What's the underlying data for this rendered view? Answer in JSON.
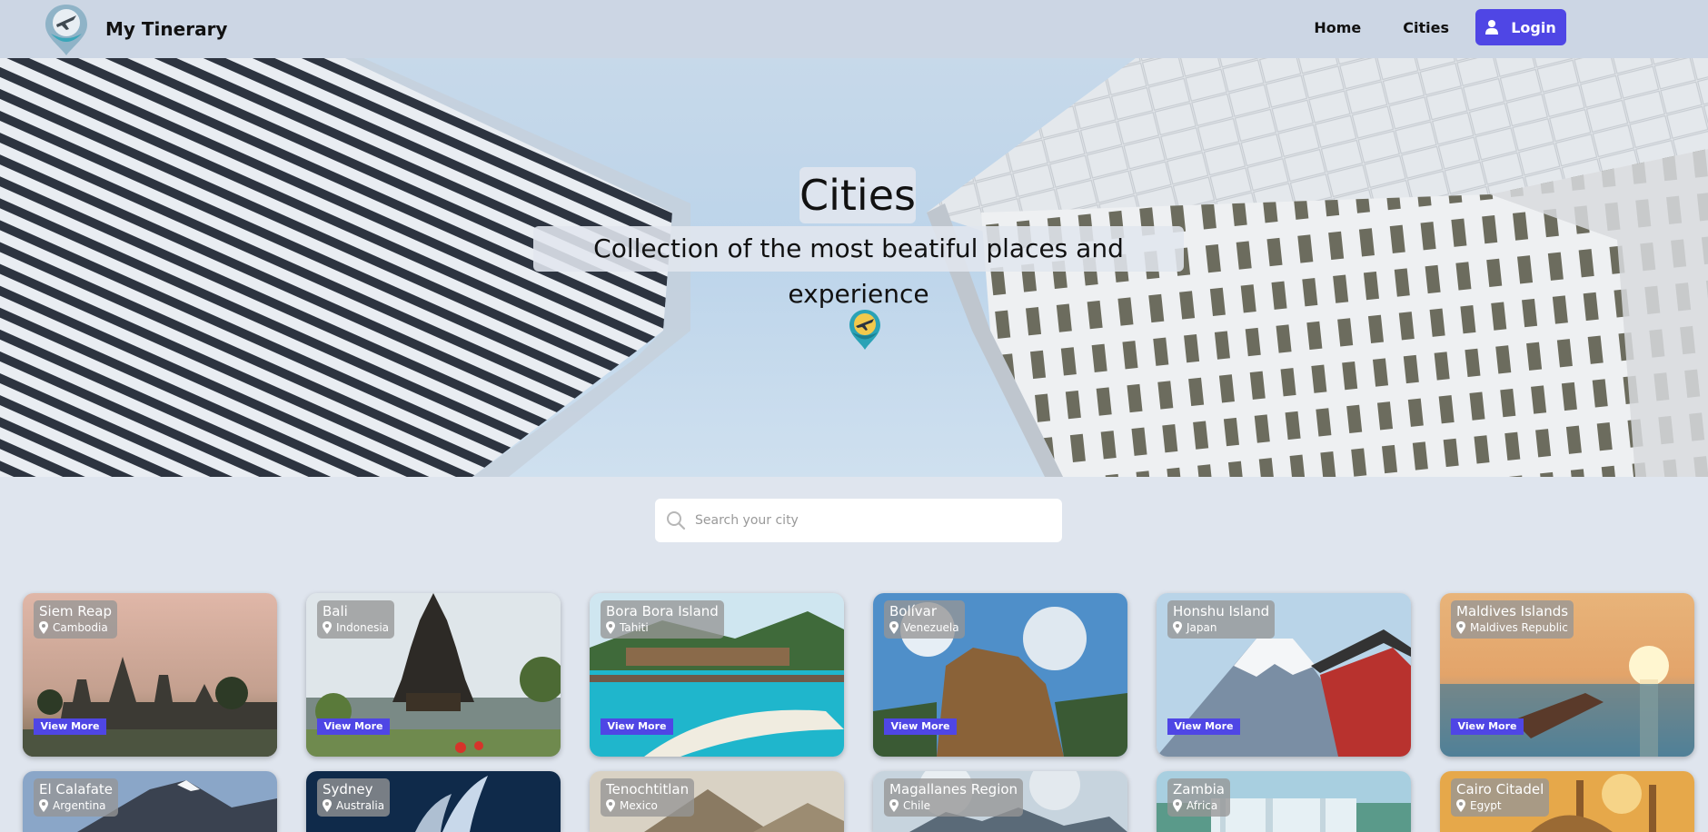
{
  "nav": {
    "brand": "My Tinerary",
    "home": "Home",
    "cities": "Cities",
    "login": "Login"
  },
  "hero": {
    "title": "Cities",
    "subtitle": "Collection of the most beatiful places and experience"
  },
  "search": {
    "placeholder": "Search your city"
  },
  "view_more_label": "View More",
  "cities": [
    {
      "city": "Siem Reap",
      "country": "Cambodia"
    },
    {
      "city": "Bali",
      "country": "Indonesia"
    },
    {
      "city": "Bora Bora Island",
      "country": "Tahiti"
    },
    {
      "city": "Bolívar",
      "country": "Venezuela"
    },
    {
      "city": "Honshu Island",
      "country": "Japan"
    },
    {
      "city": "Maldives Islands",
      "country": "Maldives Republic"
    },
    {
      "city": "El Calafate",
      "country": "Argentina"
    },
    {
      "city": "Sydney",
      "country": "Australia"
    },
    {
      "city": "Tenochtitlan",
      "country": "Mexico"
    },
    {
      "city": "Magallanes Region",
      "country": "Chile"
    },
    {
      "city": "Zambia",
      "country": "Africa"
    },
    {
      "city": "Cairo Citadel",
      "country": "Egypt"
    }
  ],
  "colors": {
    "accent": "#4f46e5",
    "navbar": "#ccd6e4",
    "page_bg": "#dfe5ee"
  }
}
